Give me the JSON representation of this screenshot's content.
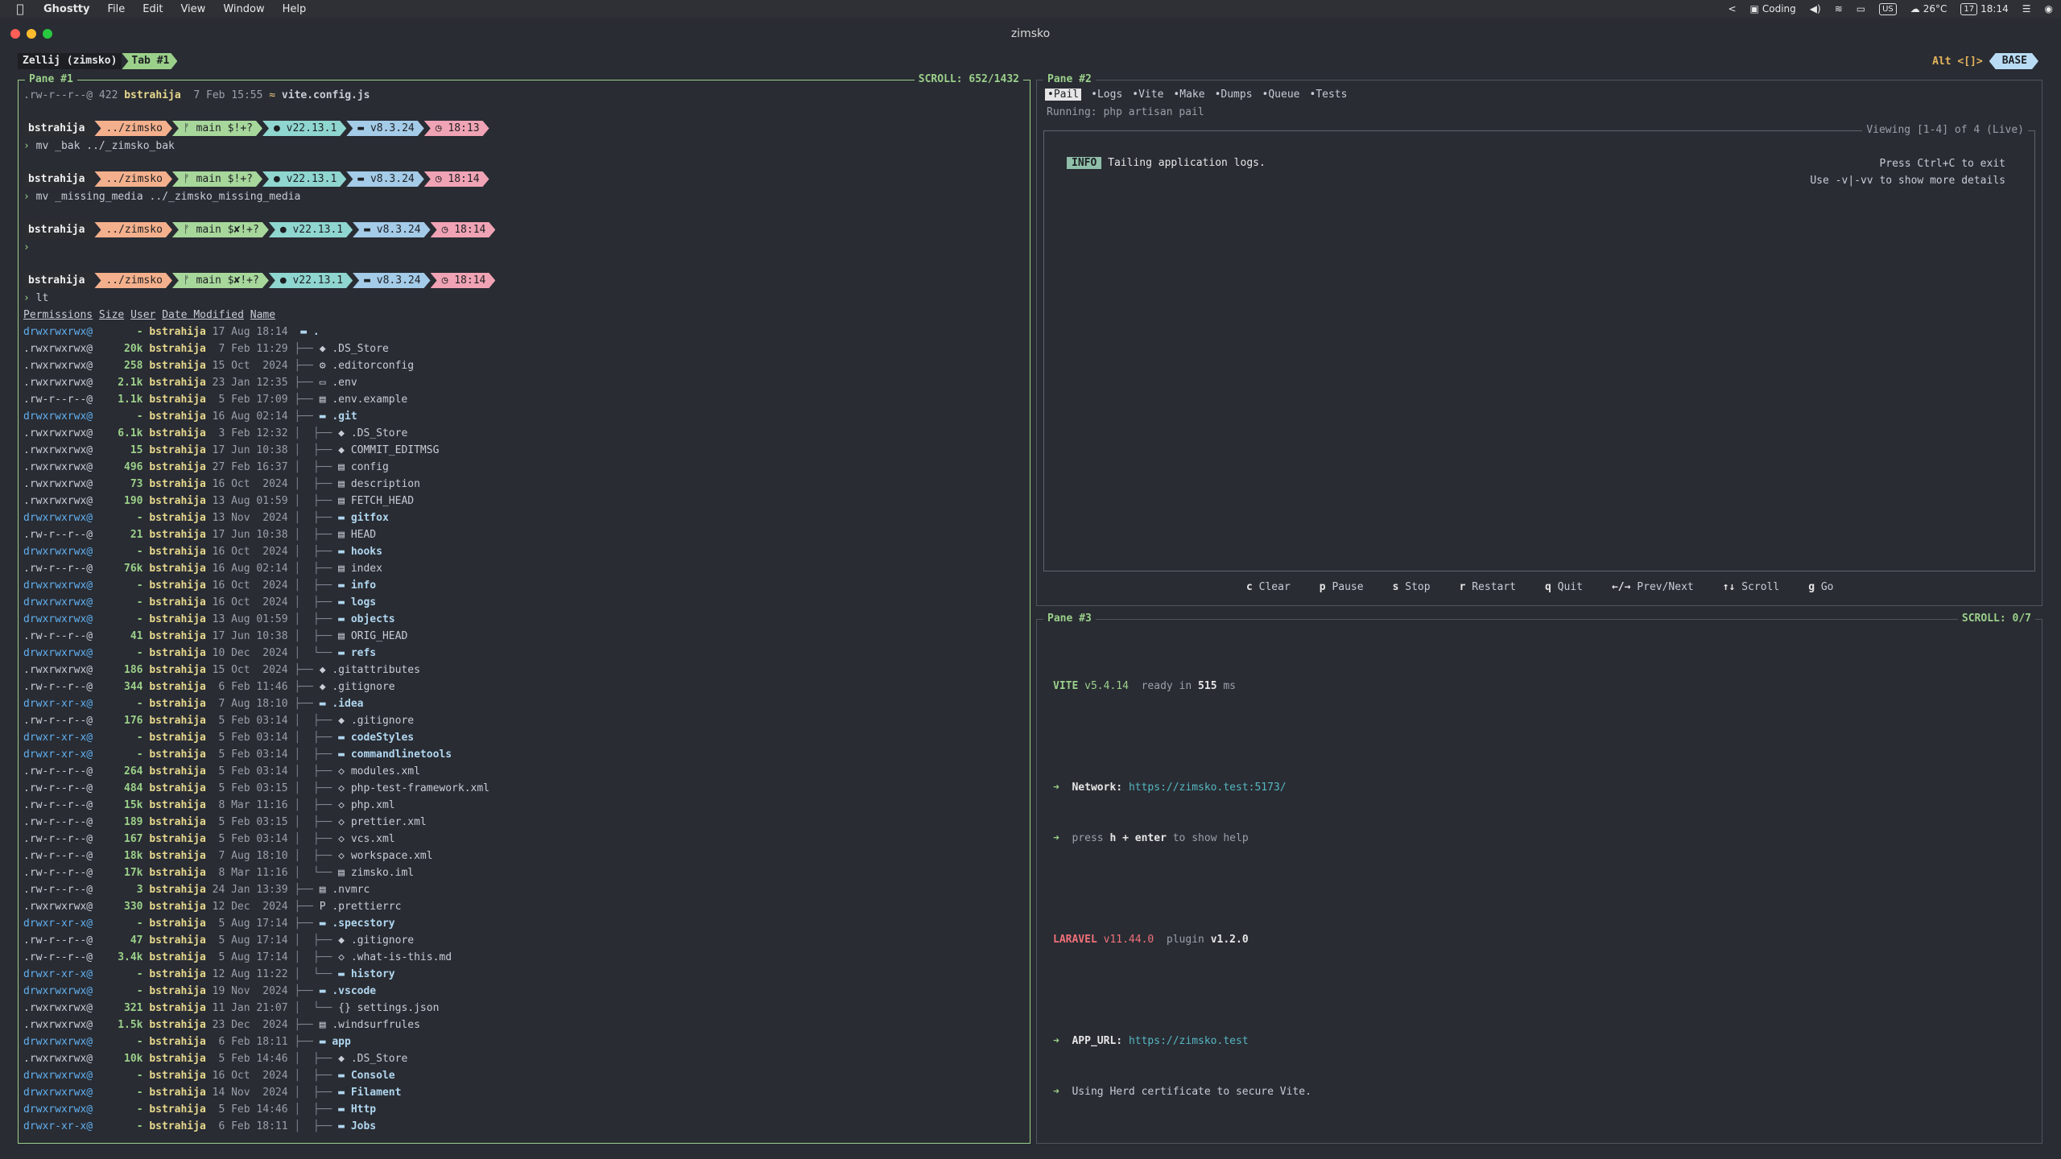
{
  "menubar": {
    "app": "Ghostty",
    "items": [
      "File",
      "Edit",
      "View",
      "Window",
      "Help"
    ],
    "right": {
      "arrow": "<",
      "focus": "Coding",
      "kbd": "US",
      "weather": "26°C",
      "date_icon": "17",
      "time": "18:14"
    }
  },
  "window": {
    "title": "zimsko"
  },
  "tabbar": {
    "session": "Zellij (zimsko)",
    "tab": "Tab #1",
    "mode_hint": "Alt <[]>",
    "mode": "BASE"
  },
  "pane1": {
    "title": "Pane #1",
    "scroll": "SCROLL:  652/1432",
    "first_line": {
      "perm": ".rw-r--r--@",
      "size": "422",
      "user": "bstrahija",
      "date": " 7 Feb 15:55",
      "icon": "≈",
      "name": "vite.config.js"
    },
    "prompts": [
      {
        "user": "bstrahija",
        "dir": "../zimsko",
        "git": "main $!+?",
        "node": "v22.13.1",
        "php": "v8.3.24",
        "time": "18:13",
        "cmd": "mv _bak ../_zimsko_bak"
      },
      {
        "user": "bstrahija",
        "dir": "../zimsko",
        "git": "main $!+?",
        "node": "v22.13.1",
        "php": "v8.3.24",
        "time": "18:14",
        "cmd": "mv _missing_media ../_zimsko_missing_media"
      },
      {
        "user": "bstrahija",
        "dir": "../zimsko",
        "git": "main $✘!+?",
        "node": "v22.13.1",
        "php": "v8.3.24",
        "time": "18:14",
        "cmd": ""
      },
      {
        "user": "bstrahija",
        "dir": "../zimsko",
        "git": "main $✘!+?",
        "node": "v22.13.1",
        "php": "v8.3.24",
        "time": "18:14",
        "cmd": "lt"
      }
    ],
    "headers": [
      "Permissions",
      "Size",
      "User",
      "Date Modified",
      "Name"
    ],
    "rows": [
      [
        "drwxrwxrwx@",
        "-",
        "bstrahija",
        "17 Aug 18:14",
        "",
        "▬ .",
        "d"
      ],
      [
        ".rwxrwxrwx@",
        "20k",
        "bstrahija",
        " 7 Feb 11:29",
        "├──",
        "◆ .DS_Store",
        "f"
      ],
      [
        ".rwxrwxrwx@",
        "258",
        "bstrahija",
        "15 Oct  2024",
        "├──",
        "⚙ .editorconfig",
        "f"
      ],
      [
        ".rwxrwxrwx@",
        "2.1k",
        "bstrahija",
        "23 Jan 12:35",
        "├──",
        "▭ .env",
        "f"
      ],
      [
        ".rw-r--r--@",
        "1.1k",
        "bstrahija",
        " 5 Feb 17:09",
        "├──",
        "▤ .env.example",
        "f"
      ],
      [
        "drwxrwxrwx@",
        "-",
        "bstrahija",
        "16 Aug 02:14",
        "├──",
        "▬ .git",
        "d"
      ],
      [
        ".rwxrwxrwx@",
        "6.1k",
        "bstrahija",
        " 3 Feb 12:32",
        "│  ├──",
        "◆ .DS_Store",
        "f"
      ],
      [
        ".rwxrwxrwx@",
        "15",
        "bstrahija",
        "17 Jun 10:38",
        "│  ├──",
        "◆ COMMIT_EDITMSG",
        "f"
      ],
      [
        ".rwxrwxrwx@",
        "496",
        "bstrahija",
        "27 Feb 16:37",
        "│  ├──",
        "▤ config",
        "f"
      ],
      [
        ".rwxrwxrwx@",
        "73",
        "bstrahija",
        "16 Oct  2024",
        "│  ├──",
        "▤ description",
        "f"
      ],
      [
        ".rwxrwxrwx@",
        "190",
        "bstrahija",
        "13 Aug 01:59",
        "│  ├──",
        "▤ FETCH_HEAD",
        "f"
      ],
      [
        "drwxrwxrwx@",
        "-",
        "bstrahija",
        "13 Nov  2024",
        "│  ├──",
        "▬ gitfox",
        "d"
      ],
      [
        ".rw-r--r--@",
        "21",
        "bstrahija",
        "17 Jun 10:38",
        "│  ├──",
        "▤ HEAD",
        "f"
      ],
      [
        "drwxrwxrwx@",
        "-",
        "bstrahija",
        "16 Oct  2024",
        "│  ├──",
        "▬ hooks",
        "d"
      ],
      [
        ".rw-r--r--@",
        "76k",
        "bstrahija",
        "16 Aug 02:14",
        "│  ├──",
        "▤ index",
        "f"
      ],
      [
        "drwxrwxrwx@",
        "-",
        "bstrahija",
        "16 Oct  2024",
        "│  ├──",
        "▬ info",
        "d"
      ],
      [
        "drwxrwxrwx@",
        "-",
        "bstrahija",
        "16 Oct  2024",
        "│  ├──",
        "▬ logs",
        "d"
      ],
      [
        "drwxrwxrwx@",
        "-",
        "bstrahija",
        "13 Aug 01:59",
        "│  ├──",
        "▬ objects",
        "d"
      ],
      [
        ".rw-r--r--@",
        "41",
        "bstrahija",
        "17 Jun 10:38",
        "│  ├──",
        "▤ ORIG_HEAD",
        "f"
      ],
      [
        "drwxrwxrwx@",
        "-",
        "bstrahija",
        "10 Dec  2024",
        "│  └──",
        "▬ refs",
        "d"
      ],
      [
        ".rwxrwxrwx@",
        "186",
        "bstrahija",
        "15 Oct  2024",
        "├──",
        "◆ .gitattributes",
        "f"
      ],
      [
        ".rw-r--r--@",
        "344",
        "bstrahija",
        " 6 Feb 11:46",
        "├──",
        "◆ .gitignore",
        "f"
      ],
      [
        "drwxr-xr-x@",
        "-",
        "bstrahija",
        " 7 Aug 18:10",
        "├──",
        "▬ .idea",
        "d"
      ],
      [
        ".rw-r--r--@",
        "176",
        "bstrahija",
        " 5 Feb 03:14",
        "│  ├──",
        "◆ .gitignore",
        "f"
      ],
      [
        "drwxr-xr-x@",
        "-",
        "bstrahija",
        " 5 Feb 03:14",
        "│  ├──",
        "▬ codeStyles",
        "d"
      ],
      [
        "drwxr-xr-x@",
        "-",
        "bstrahija",
        " 5 Feb 03:14",
        "│  ├──",
        "▬ commandlinetools",
        "d"
      ],
      [
        ".rw-r--r--@",
        "264",
        "bstrahija",
        " 5 Feb 03:14",
        "│  ├──",
        "◇ modules.xml",
        "f"
      ],
      [
        ".rw-r--r--@",
        "484",
        "bstrahija",
        " 5 Feb 03:15",
        "│  ├──",
        "◇ php-test-framework.xml",
        "f"
      ],
      [
        ".rw-r--r--@",
        "15k",
        "bstrahija",
        " 8 Mar 11:16",
        "│  ├──",
        "◇ php.xml",
        "f"
      ],
      [
        ".rw-r--r--@",
        "189",
        "bstrahija",
        " 5 Feb 03:15",
        "│  ├──",
        "◇ prettier.xml",
        "f"
      ],
      [
        ".rw-r--r--@",
        "167",
        "bstrahija",
        " 5 Feb 03:14",
        "│  ├──",
        "◇ vcs.xml",
        "f"
      ],
      [
        ".rw-r--r--@",
        "18k",
        "bstrahija",
        " 7 Aug 18:10",
        "│  ├──",
        "◇ workspace.xml",
        "f"
      ],
      [
        ".rw-r--r--@",
        "17k",
        "bstrahija",
        " 8 Mar 11:16",
        "│  └──",
        "▤ zimsko.iml",
        "f"
      ],
      [
        ".rw-r--r--@",
        "3",
        "bstrahija",
        "24 Jan 13:39",
        "├──",
        "▤ .nvmrc",
        "f"
      ],
      [
        ".rwxrwxrwx@",
        "330",
        "bstrahija",
        "12 Dec  2024",
        "├──",
        "P .prettierrc",
        "f"
      ],
      [
        "drwxr-xr-x@",
        "-",
        "bstrahija",
        " 5 Aug 17:14",
        "├──",
        "▬ .specstory",
        "d"
      ],
      [
        ".rw-r--r--@",
        "47",
        "bstrahija",
        " 5 Aug 17:14",
        "│  ├──",
        "◆ .gitignore",
        "f"
      ],
      [
        ".rw-r--r--@",
        "3.4k",
        "bstrahija",
        " 5 Aug 17:14",
        "│  ├──",
        "◇ .what-is-this.md",
        "f"
      ],
      [
        "drwxr-xr-x@",
        "-",
        "bstrahija",
        "12 Aug 11:22",
        "│  └──",
        "▬ history",
        "d"
      ],
      [
        "drwxrwxrwx@",
        "-",
        "bstrahija",
        "19 Nov  2024",
        "├──",
        "▬ .vscode",
        "d"
      ],
      [
        ".rwxrwxrwx@",
        "321",
        "bstrahija",
        "11 Jan 21:07",
        "│  └──",
        "{} settings.json",
        "f"
      ],
      [
        ".rwxrwxrwx@",
        "1.5k",
        "bstrahija",
        "23 Dec  2024",
        "├──",
        "▤ .windsurfrules",
        "f"
      ],
      [
        "drwxrwxrwx@",
        "-",
        "bstrahija",
        " 6 Feb 18:11",
        "├──",
        "▬ app",
        "d"
      ],
      [
        ".rwxrwxrwx@",
        "10k",
        "bstrahija",
        " 5 Feb 14:46",
        "│  ├──",
        "◆ .DS_Store",
        "f"
      ],
      [
        "drwxrwxrwx@",
        "-",
        "bstrahija",
        "16 Oct  2024",
        "│  ├──",
        "▬ Console",
        "d"
      ],
      [
        "drwxrwxrwx@",
        "-",
        "bstrahija",
        "14 Nov  2024",
        "│  ├──",
        "▬ Filament",
        "d"
      ],
      [
        "drwxrwxrwx@",
        "-",
        "bstrahija",
        " 5 Feb 14:46",
        "│  ├──",
        "▬ Http",
        "d"
      ],
      [
        "drwxr-xr-x@",
        "-",
        "bstrahija",
        " 6 Feb 18:11",
        "│  ├──",
        "▬ Jobs",
        "d"
      ]
    ]
  },
  "pane2": {
    "title": "Pane #2",
    "tabs": [
      "•Pail",
      "•Logs",
      "•Vite",
      "•Make",
      "•Dumps",
      "•Queue",
      "•Tests"
    ],
    "running": "Running: php artisan pail",
    "viewing": "Viewing [1-4] of 4 (Live)",
    "info_badge": "INFO",
    "info_text": "Tailing application logs.",
    "hint1": "Press Ctrl+C to exit",
    "hint2": "Use -v|-vv to show more details",
    "footer": [
      {
        "key": "c",
        "label": "Clear"
      },
      {
        "key": "p",
        "label": "Pause"
      },
      {
        "key": "s",
        "label": "Stop"
      },
      {
        "key": "r",
        "label": "Restart"
      },
      {
        "key": "q",
        "label": "Quit"
      },
      {
        "key": "←/→",
        "label": "Prev/Next"
      },
      {
        "key": "↑↓",
        "label": "Scroll"
      },
      {
        "key": "g",
        "label": "Go"
      }
    ]
  },
  "pane3": {
    "title": "Pane #3",
    "scroll": "SCROLL:  0/7",
    "vite": "VITE",
    "vite_ver": "v5.4.14",
    "ready": "ready in",
    "ready_ms": "515",
    "ms": "ms",
    "network_label": "Network:",
    "network_url": "https://zimsko.test:5173/",
    "press": "press",
    "press_keys": "h + enter",
    "press_rest": "to show help",
    "laravel": "LARAVEL",
    "laravel_ver": "v11.44.0",
    "plugin": "plugin",
    "plugin_ver": "v1.2.0",
    "app_url_label": "APP_URL:",
    "app_url": "https://zimsko.test",
    "herd": "Using Herd certificate to secure Vite."
  },
  "colors": {
    "accent_green": "#9bd08a",
    "pane_bg": "#292c33",
    "info_bg": "#8fbfa8"
  }
}
